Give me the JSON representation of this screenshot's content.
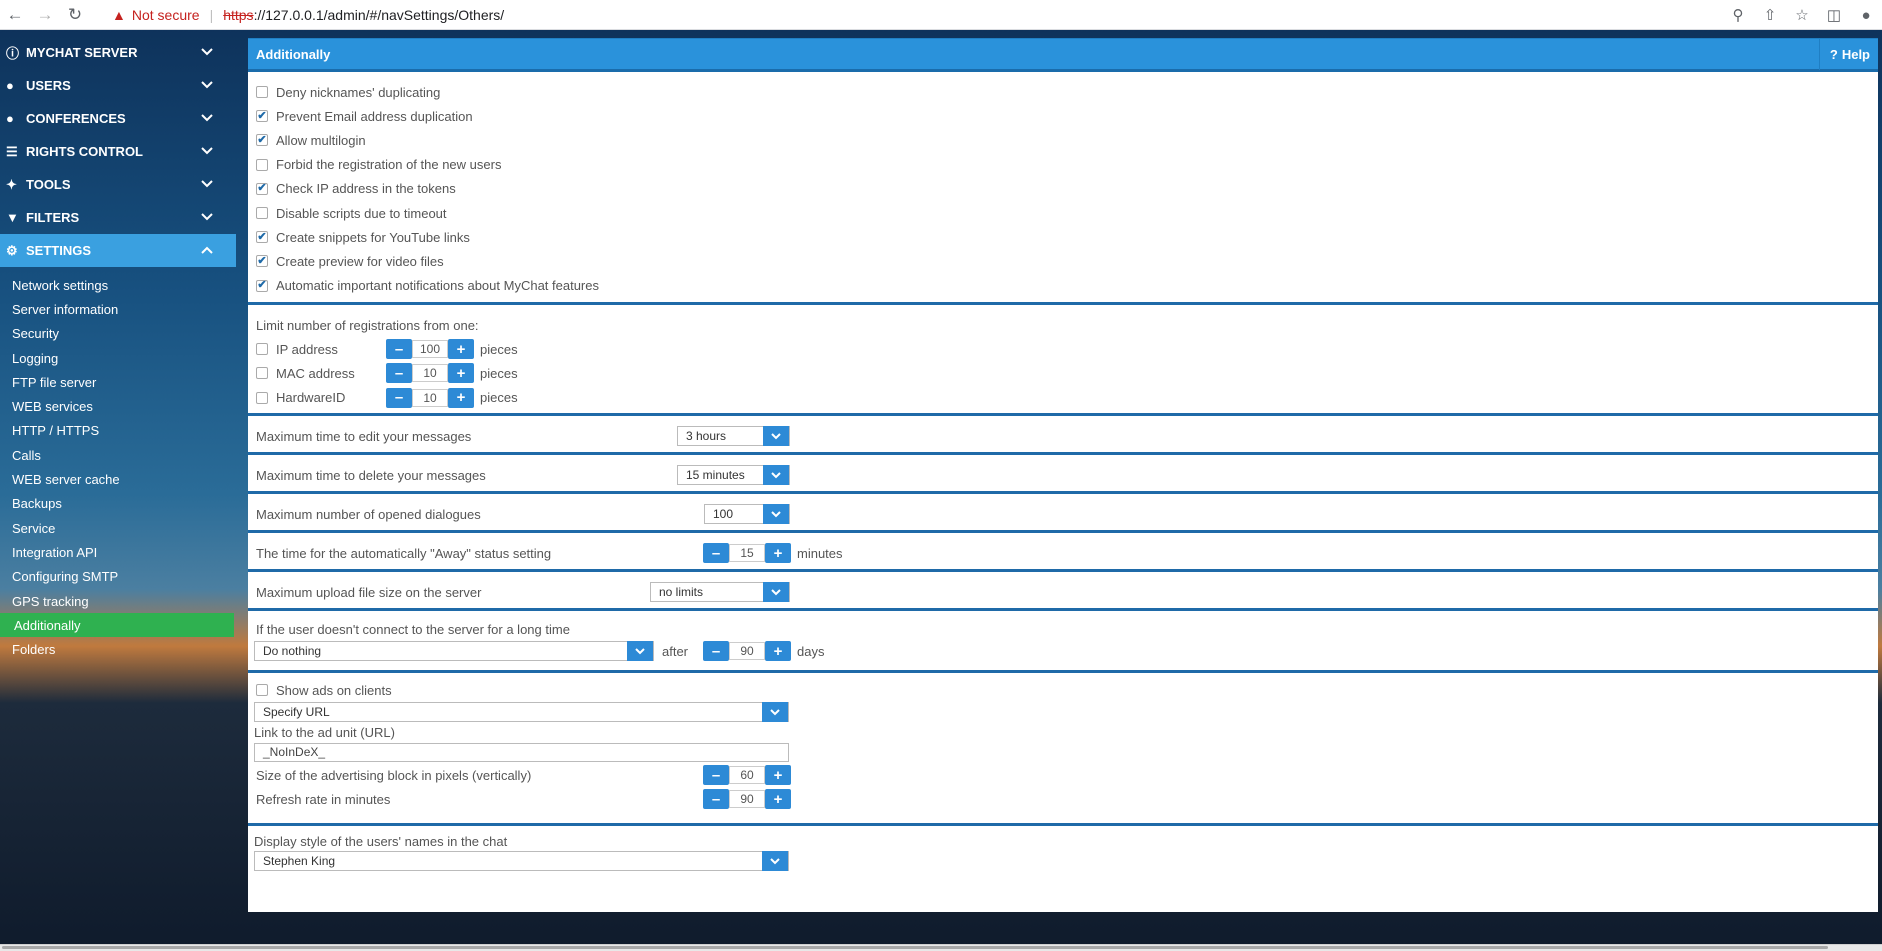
{
  "browser": {
    "not_secure": "Not secure",
    "url_scheme": "https",
    "url_rest": "://127.0.0.1/admin/#/navSettings/Others/"
  },
  "sidebar": {
    "menus": [
      {
        "label": "MYCHAT SERVER",
        "icon": "info-icon"
      },
      {
        "label": "USERS",
        "icon": "users-icon"
      },
      {
        "label": "CONFERENCES",
        "icon": "conferences-icon"
      },
      {
        "label": "RIGHTS CONTROL",
        "icon": "list-icon"
      },
      {
        "label": "TOOLS",
        "icon": "wrench-icon"
      },
      {
        "label": "FILTERS",
        "icon": "filter-icon"
      },
      {
        "label": "SETTINGS",
        "icon": "gears-icon"
      }
    ],
    "settings_items": [
      "Network settings",
      "Server information",
      "Security",
      "Logging",
      "FTP file server",
      "WEB services",
      "HTTP / HTTPS",
      "Calls",
      "WEB server cache",
      "Backups",
      "Service",
      "Integration API",
      "Configuring SMTP",
      "GPS tracking",
      "Additionally",
      "Folders"
    ],
    "active_item": "Additionally"
  },
  "header": {
    "title": "Additionally",
    "help": "Help"
  },
  "options": [
    {
      "label": "Deny nicknames' duplicating",
      "checked": false
    },
    {
      "label": "Prevent Email address duplication",
      "checked": true
    },
    {
      "label": "Allow multilogin",
      "checked": true
    },
    {
      "label": "Forbid the registration of the new users",
      "checked": false
    },
    {
      "label": "Check IP address in the tokens",
      "checked": true
    },
    {
      "label": "Disable scripts due to timeout",
      "checked": false
    },
    {
      "label": "Create snippets for YouTube links",
      "checked": true
    },
    {
      "label": "Create preview for video files",
      "checked": true
    },
    {
      "label": "Automatic important notifications about MyChat features",
      "checked": true
    }
  ],
  "limits": {
    "title": "Limit number of registrations from one:",
    "unit": "pieces",
    "rows": [
      {
        "label": "IP address",
        "value": "100",
        "checked": false
      },
      {
        "label": "MAC address",
        "value": "10",
        "checked": false
      },
      {
        "label": "HardwareID",
        "value": "10",
        "checked": false
      }
    ]
  },
  "edit_time": {
    "label": "Maximum time to edit your messages",
    "value": "3 hours"
  },
  "delete_time": {
    "label": "Maximum time to delete your messages",
    "value": "15 minutes"
  },
  "dialogues": {
    "label": "Maximum number of opened dialogues",
    "value": "100"
  },
  "away": {
    "label": "The time for the automatically \"Away\" status setting",
    "value": "15",
    "unit": "minutes"
  },
  "upload": {
    "label": "Maximum upload file size on the server",
    "value": "no limits"
  },
  "inactive": {
    "label": "If the user doesn't connect to the server for a long time",
    "action": "Do nothing",
    "after": "after",
    "value": "90",
    "unit": "days"
  },
  "ads": {
    "show_label": "Show ads on clients",
    "show_checked": false,
    "url_select": "Specify URL",
    "link_label": "Link to the ad unit (URL)",
    "link_value": "_NoInDeX_",
    "size_label": "Size of the advertising block in pixels (vertically)",
    "size_value": "60",
    "refresh_label": "Refresh rate in minutes",
    "refresh_value": "90"
  },
  "display_style": {
    "label": "Display style of the users' names in the chat",
    "value": "Stephen King"
  },
  "colors": {
    "header": "#2a92db",
    "active_menu": "#3aa0e0",
    "active_item": "#2fb150",
    "button": "#2d8ad6"
  }
}
